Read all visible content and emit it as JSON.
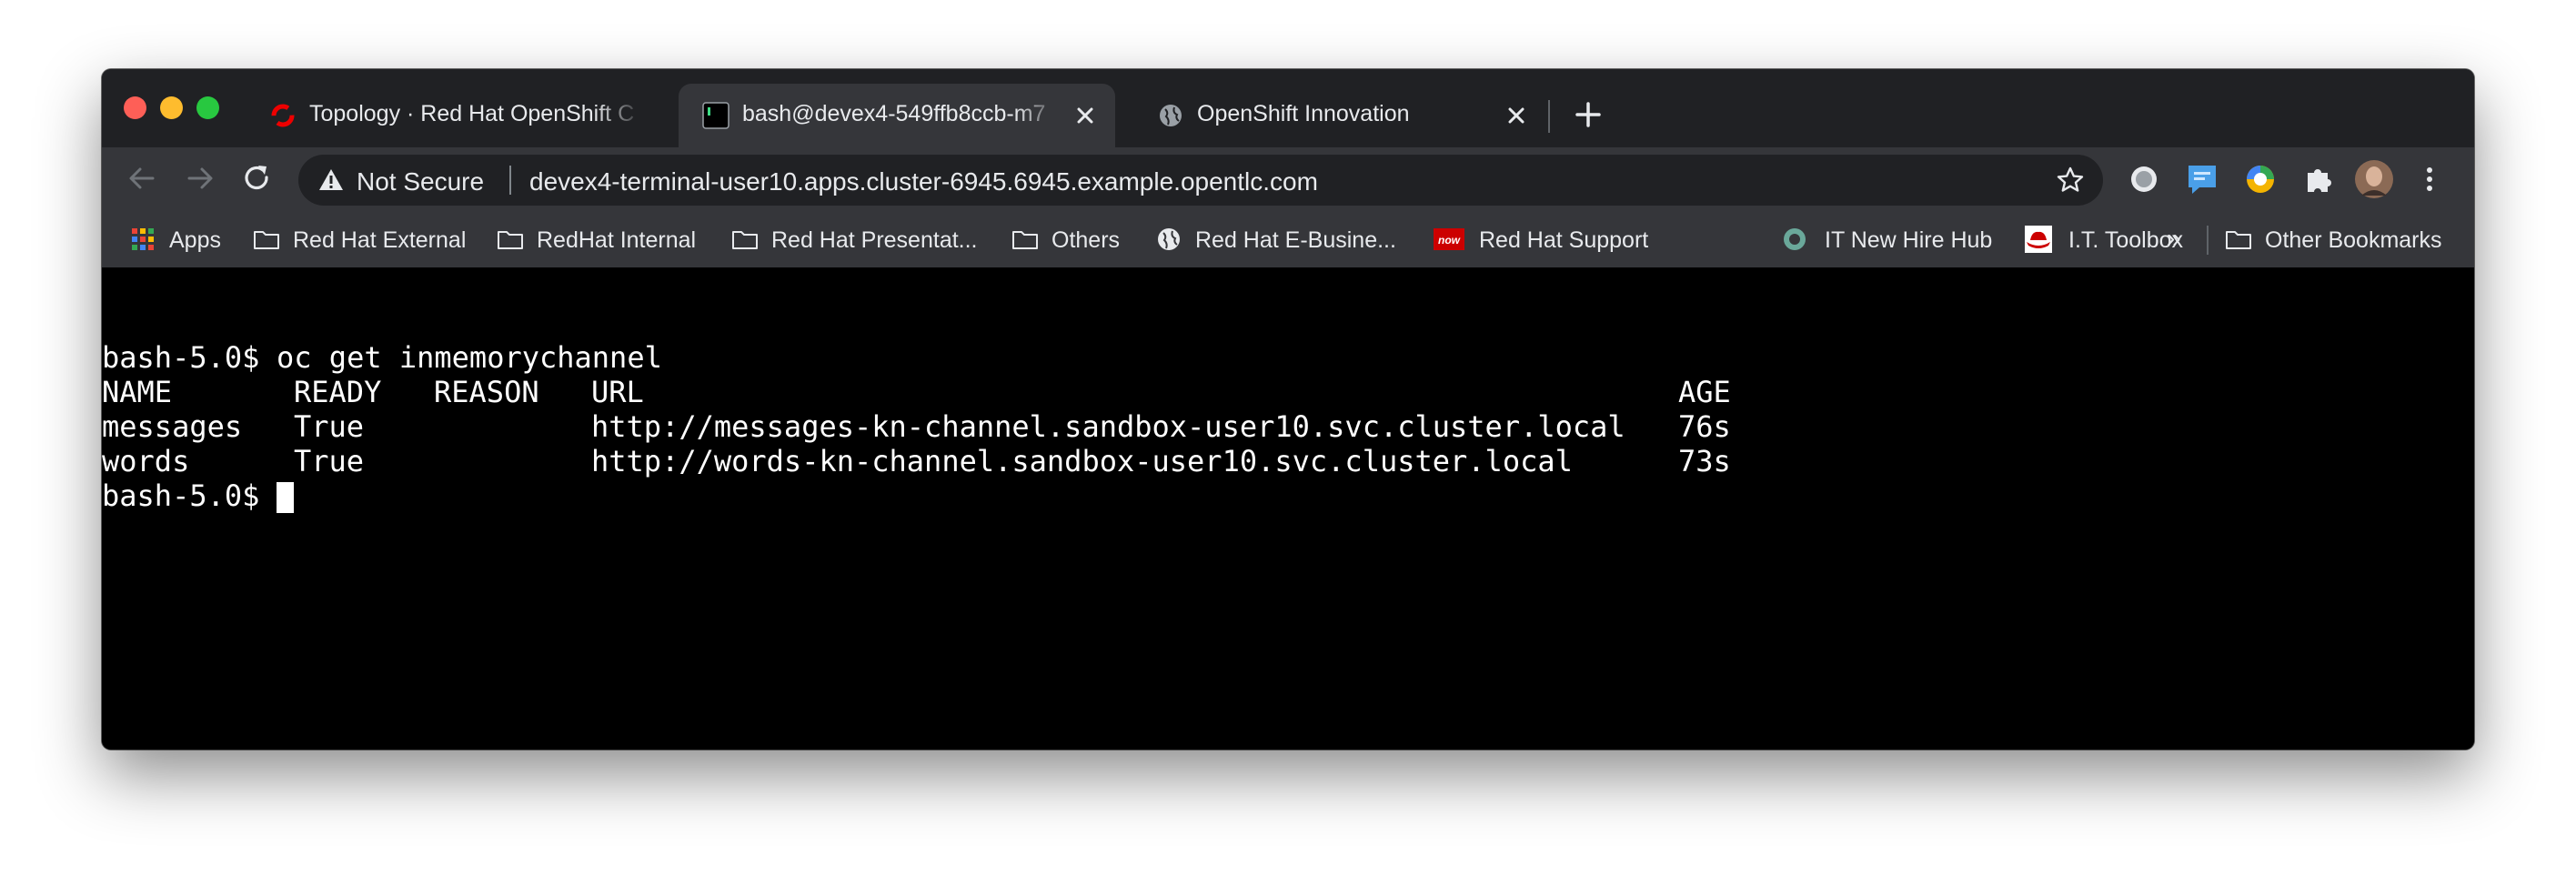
{
  "tabs": [
    {
      "title": "Topology · Red Hat OpenShift C",
      "icon": "openshift-icon",
      "active": false
    },
    {
      "title": "bash@devex4-549ffb8ccb-m7",
      "icon": "terminal-icon",
      "active": true
    },
    {
      "title": "OpenShift Innovation",
      "icon": "globe-icon",
      "active": false
    }
  ],
  "address_bar": {
    "security_label": "Not Secure",
    "url": "devex4-terminal-user10.apps.cluster-6945.6945.example.opentlc.com"
  },
  "bookmarks": [
    {
      "label": "Apps",
      "icon": "apps-grid-icon"
    },
    {
      "label": "Red Hat External",
      "icon": "folder-icon"
    },
    {
      "label": "RedHat Internal",
      "icon": "folder-icon"
    },
    {
      "label": "Red Hat Presentat...",
      "icon": "folder-icon"
    },
    {
      "label": "Others",
      "icon": "folder-icon"
    },
    {
      "label": "Red Hat E-Busine...",
      "icon": "globe-icon"
    },
    {
      "label": "Red Hat Support",
      "icon": "servicenow-icon",
      "icon_text": "now"
    },
    {
      "label": "IT New Hire Hub",
      "icon": "hub-icon"
    },
    {
      "label": "I.T. Toolbox",
      "icon": "redhat-shadowman-icon"
    }
  ],
  "bookmarks_overflow": "»",
  "other_bookmarks": "Other Bookmarks",
  "terminal": {
    "prompt": "bash-5.0$",
    "command": "oc get inmemorychannel",
    "headers": [
      "NAME",
      "READY",
      "REASON",
      "URL",
      "AGE"
    ],
    "rows": [
      [
        "messages",
        "True",
        "",
        "http://messages-kn-channel.sandbox-user10.svc.cluster.local",
        "76s"
      ],
      [
        "words",
        "True",
        "",
        "http://words-kn-channel.sandbox-user10.svc.cluster.local",
        "73s"
      ]
    ]
  },
  "colors": {
    "tab_strip": "#202124",
    "toolbar": "#35363a",
    "terminal_bg": "#000000",
    "terminal_fg": "#ffffff",
    "openshift_red": "#ee0000"
  }
}
